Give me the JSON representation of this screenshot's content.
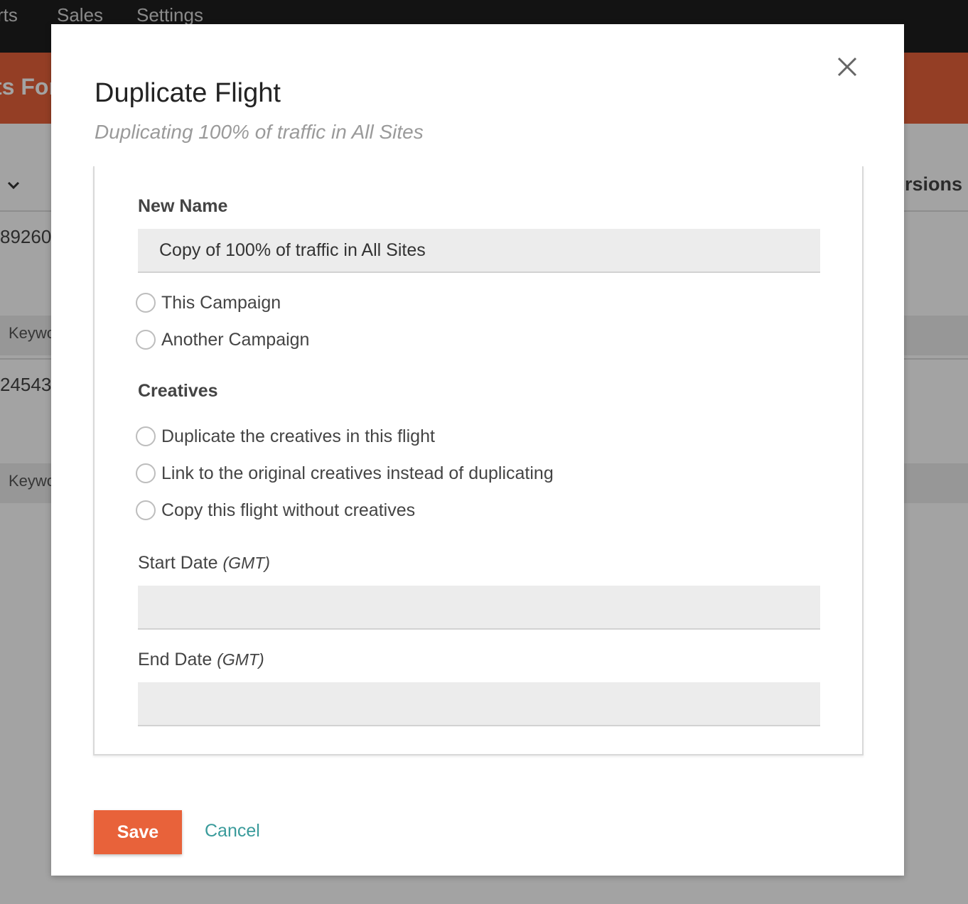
{
  "background": {
    "nav_items": [
      "rts",
      "Sales",
      "Settings"
    ],
    "header_title": "ts For",
    "column_header": "ersions",
    "rows": [
      {
        "number": "89260",
        "tag": "Keywo"
      },
      {
        "number": "24543",
        "tag": "Keywo"
      }
    ]
  },
  "modal": {
    "title": "Duplicate Flight",
    "subtitle": "Duplicating 100% of traffic in All Sites",
    "close_icon": "close-icon",
    "new_name": {
      "label": "New Name",
      "value": "Copy of 100% of traffic in All Sites"
    },
    "campaign_options": [
      "This Campaign",
      "Another Campaign"
    ],
    "creatives": {
      "label": "Creatives",
      "options": [
        "Duplicate the creatives in this flight",
        "Link to the original creatives instead of duplicating",
        "Copy this flight without creatives"
      ]
    },
    "start_date": {
      "label": "Start Date",
      "tz": "(GMT)",
      "value": ""
    },
    "end_date": {
      "label": "End Date",
      "tz": "(GMT)",
      "value": ""
    },
    "save_label": "Save",
    "cancel_label": "Cancel"
  },
  "colors": {
    "accent": "#e8623a",
    "link": "#3a9b9b"
  }
}
